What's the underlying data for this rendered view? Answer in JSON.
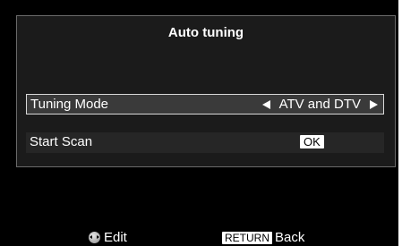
{
  "dialog": {
    "title": "Auto tuning"
  },
  "tuning_mode": {
    "label": "Tuning Mode",
    "value": "ATV and DTV"
  },
  "start_scan": {
    "label": "Start Scan",
    "button_label": "OK"
  },
  "footer": {
    "edit_label": "Edit",
    "return_key": "RETURN",
    "back_label": "Back"
  },
  "colors": {
    "background": "#000000",
    "panel": "#1b1b1b",
    "selected_row_border": "#d8d8d8"
  }
}
